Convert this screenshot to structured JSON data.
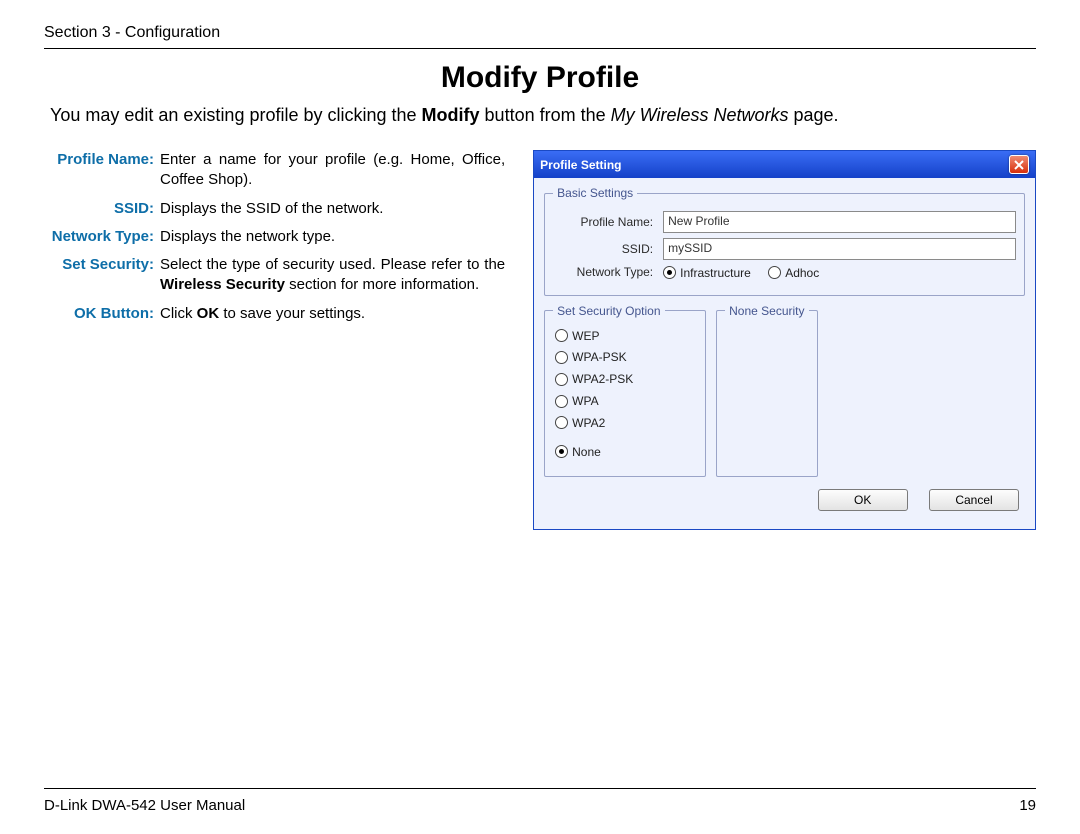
{
  "header": {
    "text": "Section 3 - Configuration"
  },
  "title": "Modify Profile",
  "intro": {
    "pre": "You may edit an existing profile by clicking the ",
    "bold": "Modify",
    "mid": " button from the ",
    "italic": "My Wireless Networks",
    "post": " page."
  },
  "defs": [
    {
      "label": "Profile Name:",
      "desc": "Enter a name for your profile (e.g. Home, Office, Coffee Shop)."
    },
    {
      "label": "SSID:",
      "desc": "Displays the SSID of the network."
    },
    {
      "label": "Network Type:",
      "desc": "Displays the network type."
    },
    {
      "label": "Set Security:",
      "desc_pre": "Select the type of security used. Please refer to the ",
      "desc_bold": "Wireless Security",
      "desc_post": " section for more information."
    },
    {
      "label": "OK Button:",
      "desc_pre": "Click ",
      "desc_bold": "OK",
      "desc_post": " to save your settings."
    }
  ],
  "panel": {
    "title": "Profile Setting",
    "basic": {
      "legend": "Basic Settings",
      "profile_label": "Profile Name:",
      "profile_value": "New Profile",
      "ssid_label": "SSID:",
      "ssid_value": "mySSID",
      "nettype_label": "Network Type:",
      "nettype_opts": [
        "Infrastructure",
        "Adhoc"
      ],
      "nettype_selected": 0
    },
    "security": {
      "legend": "Set Security Option",
      "options": [
        "WEP",
        "WPA-PSK",
        "WPA2-PSK",
        "WPA",
        "WPA2",
        "None"
      ],
      "selected": 5
    },
    "right_legend": "None Security",
    "buttons": {
      "ok": "OK",
      "cancel": "Cancel"
    }
  },
  "footer": {
    "left": "D-Link DWA-542 User Manual",
    "right": "19"
  }
}
